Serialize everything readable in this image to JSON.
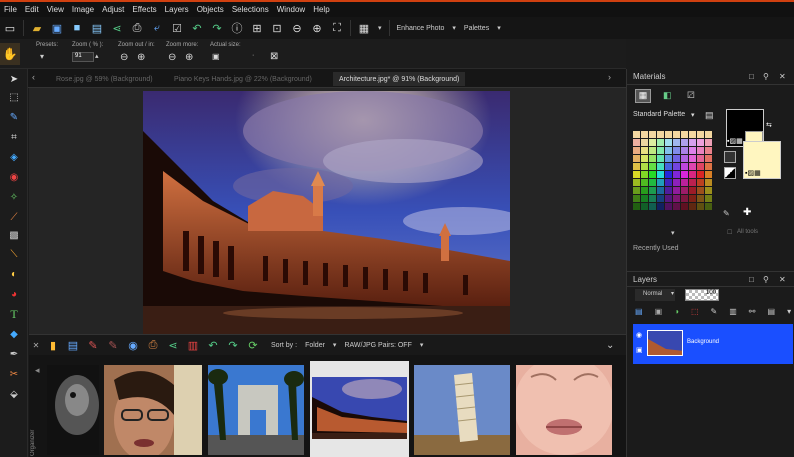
{
  "menu": [
    "File",
    "Edit",
    "View",
    "Image",
    "Adjust",
    "Effects",
    "Layers",
    "Objects",
    "Selections",
    "Window",
    "Help"
  ],
  "toolbar": {
    "enhance_label": "Enhance Photo",
    "palettes_label": "Palettes"
  },
  "options": {
    "presets_label": "Presets:",
    "zoom_label": "Zoom ( % ):",
    "zoom_value": "91",
    "zoomout_label": "Zoom out / in:",
    "zoommore_label": "Zoom more:",
    "actual_label": "Actual size:"
  },
  "tabs": [
    {
      "label": "Rose.jpg @  59% (Background)"
    },
    {
      "label": "Piano Keys Hands.jpg @  22% (Background)"
    },
    {
      "label": "Architecture.jpg* @  91% (Background)"
    }
  ],
  "organizer": {
    "sortby_label": "Sort by :",
    "folder_label": "Folder",
    "rawpairs_label": "RAW/JPG Pairs: OFF",
    "side_label": "Organizer"
  },
  "materials": {
    "title": "Materials",
    "palette_label": "Standard Palette",
    "recent_label": "Recently Used",
    "alltools_label": "All tools"
  },
  "layers": {
    "title": "Layers",
    "blend_label": "Normal",
    "opacity_value": "100",
    "layer_name": "Background"
  },
  "colors": {
    "accent": "#d04010",
    "selection": "#1a4fff",
    "foreground": "#000000",
    "background": "#fff6c0"
  }
}
